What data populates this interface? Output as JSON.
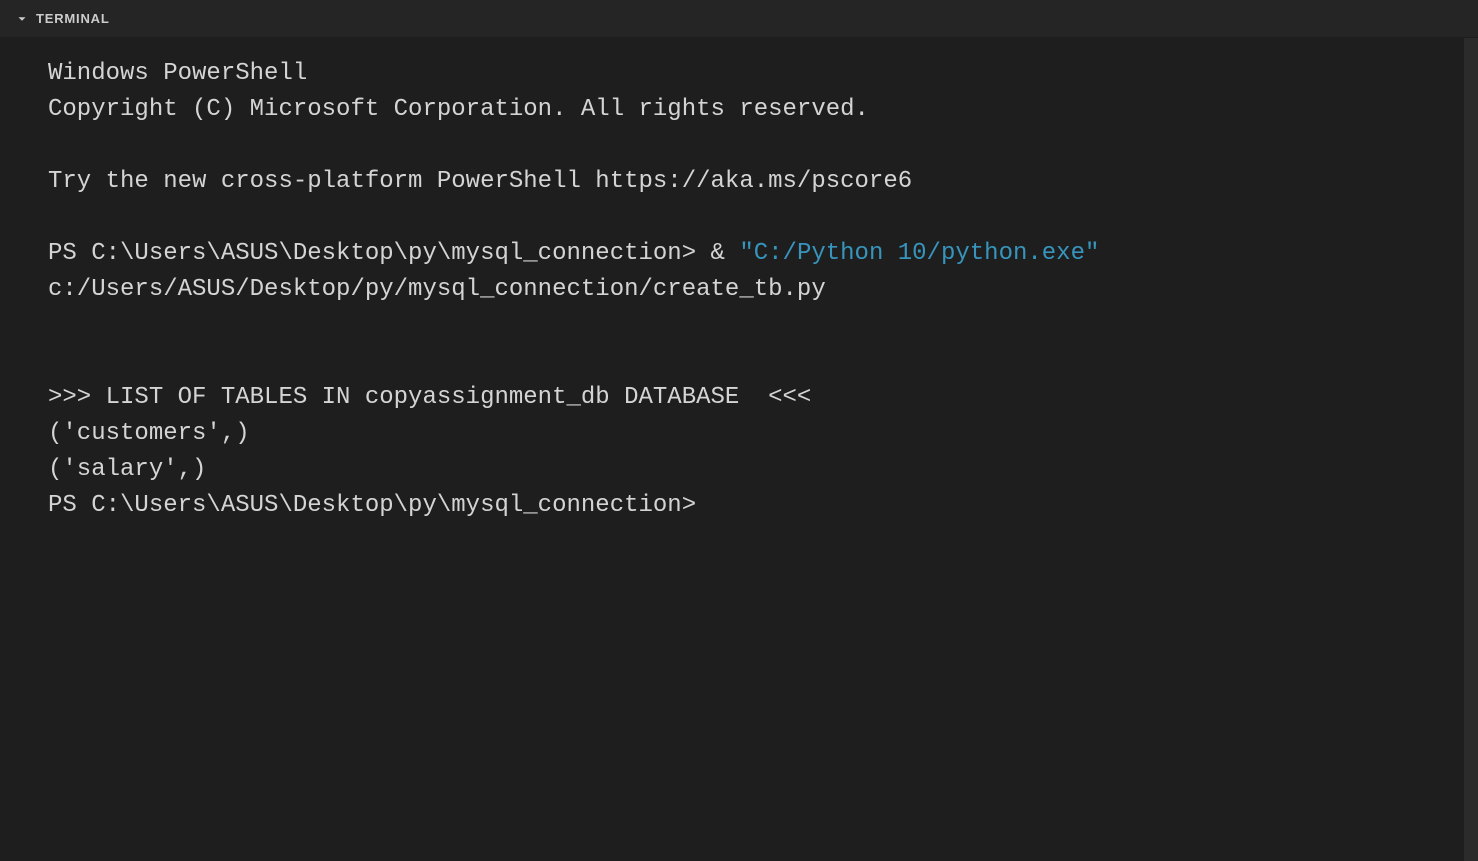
{
  "panel": {
    "title": "TERMINAL"
  },
  "terminal": {
    "header_line1": "Windows PowerShell",
    "header_line2": "Copyright (C) Microsoft Corporation. All rights reserved.",
    "suggestion": "Try the new cross-platform PowerShell https://aka.ms/pscore6",
    "prompt1_prefix": "PS C:\\Users\\ASUS\\Desktop\\py\\mysql_connection> ",
    "prompt1_operator": "& ",
    "prompt1_quoted": "\"C:/Python 10/python.exe\"",
    "prompt1_suffix": " c:/Users/ASUS/Desktop/py/mysql_connection/create_tb.py",
    "output_heading": ">>> LIST OF TABLES IN copyassignment_db DATABASE  <<<",
    "output_row1": "('customers',)",
    "output_row2": "('salary',)",
    "prompt2": "PS C:\\Users\\ASUS\\Desktop\\py\\mysql_connection>"
  }
}
